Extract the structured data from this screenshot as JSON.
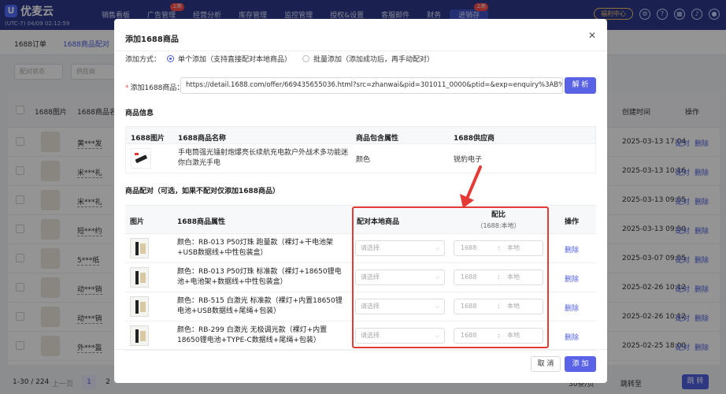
{
  "app": {
    "logo_text": "优麦云",
    "region": "(UTC-7) 04/09 02:12:59",
    "nav": [
      {
        "label": "销售看板",
        "badge": ""
      },
      {
        "label": "广告管理",
        "badge": "上新"
      },
      {
        "label": "经营分析",
        "badge": ""
      },
      {
        "label": "库存管理",
        "badge": ""
      },
      {
        "label": "监控管理",
        "badge": ""
      },
      {
        "label": "授权&设置",
        "badge": ""
      },
      {
        "label": "客服邮件",
        "badge": ""
      },
      {
        "label": "财务",
        "badge": ""
      },
      {
        "label": "进销存",
        "badge": "上新"
      }
    ],
    "promo": "福利中心"
  },
  "subtabs": [
    "1688订单",
    "1688商品配对"
  ],
  "filters": {
    "status": "配对状态",
    "supplier": "供应商"
  },
  "bg_table": {
    "headers": [
      "1688图片",
      "1688商品名",
      "创建时间",
      "操作"
    ],
    "rows": [
      {
        "name": "黄***发",
        "time": "2025-03-13 17:04"
      },
      {
        "name": "米***礼",
        "time": "2025-03-13 10:16"
      },
      {
        "name": "米***礼",
        "time": "2025-03-13 09:55"
      },
      {
        "name": "短***约",
        "time": "2025-03-13 09:50"
      },
      {
        "name": "5***纸",
        "time": "2025-03-07 09:55"
      },
      {
        "name": "动***销",
        "time": "2025-02-26 10:12"
      },
      {
        "name": "动***销",
        "time": "2025-02-26 10:12"
      },
      {
        "name": "外***盔",
        "time": "2025-02-25 18:00"
      }
    ],
    "action_match": "配对",
    "action_delete": "删除"
  },
  "pager": {
    "range": "1-30 / 224",
    "prev": "上一页",
    "page1": "1",
    "page2": "2",
    "per_page": "30条/页",
    "jump_label": "跳转至",
    "jump_btn": "跳 转"
  },
  "modal": {
    "title": "添加1688商品",
    "mode_label": "添加方式：",
    "mode_single": "单个添加（支持直接配对本地商品）",
    "mode_batch": "批量添加（添加成功后，再手动配对）",
    "url_label": "添加1688商品：",
    "url_value": "https://detail.1688.com/offer/669435655036.html?src=zhanwai&pid=301011_0000&ptid=&exp=enquiry%3AB%3E",
    "parse_btn": "解 析",
    "info_section": "商品信息",
    "info_headers": [
      "1688图片",
      "1688商品名称",
      "商品包含属性",
      "1688供应商"
    ],
    "info_row": {
      "name": "手电筒强光镭射炮爆亮长续航充电款户外战术多功能迷你白激光手电",
      "attr": "颜色",
      "supplier": "锐豹电子"
    },
    "map_section": "商品配对（可选，如果不配对仅添加1688商品）",
    "map_headers": {
      "img": "图片",
      "attr": "1688商品属性",
      "local": "配对本地商品",
      "ratio": "配比",
      "ratio_sub": "（1688:本地）",
      "op": "操作"
    },
    "rows": [
      {
        "attr": "颜色：RB-013 P50灯珠 跑量款（裸灯+干电池架+USB数据线+中性包装盒）"
      },
      {
        "attr": "颜色：RB-013 P50灯珠 标准款（裸灯+18650锂电池+电池架+数据线+中性包装盒）"
      },
      {
        "attr": "颜色：RB-515 白激光 标准款（裸灯+内置18650锂电池+USB数据线+尾绳+包装）"
      },
      {
        "attr": "颜色：RB-299 白激光 无极调光款（裸灯+内置18650锂电池+TYPE-C数据线+尾绳+包装）"
      }
    ],
    "select_placeholder": "请选择",
    "ratio_a": "1688",
    "ratio_colon": ":",
    "ratio_b": "本地",
    "delete": "删除",
    "cancel": "取 消",
    "add": "添 加"
  }
}
